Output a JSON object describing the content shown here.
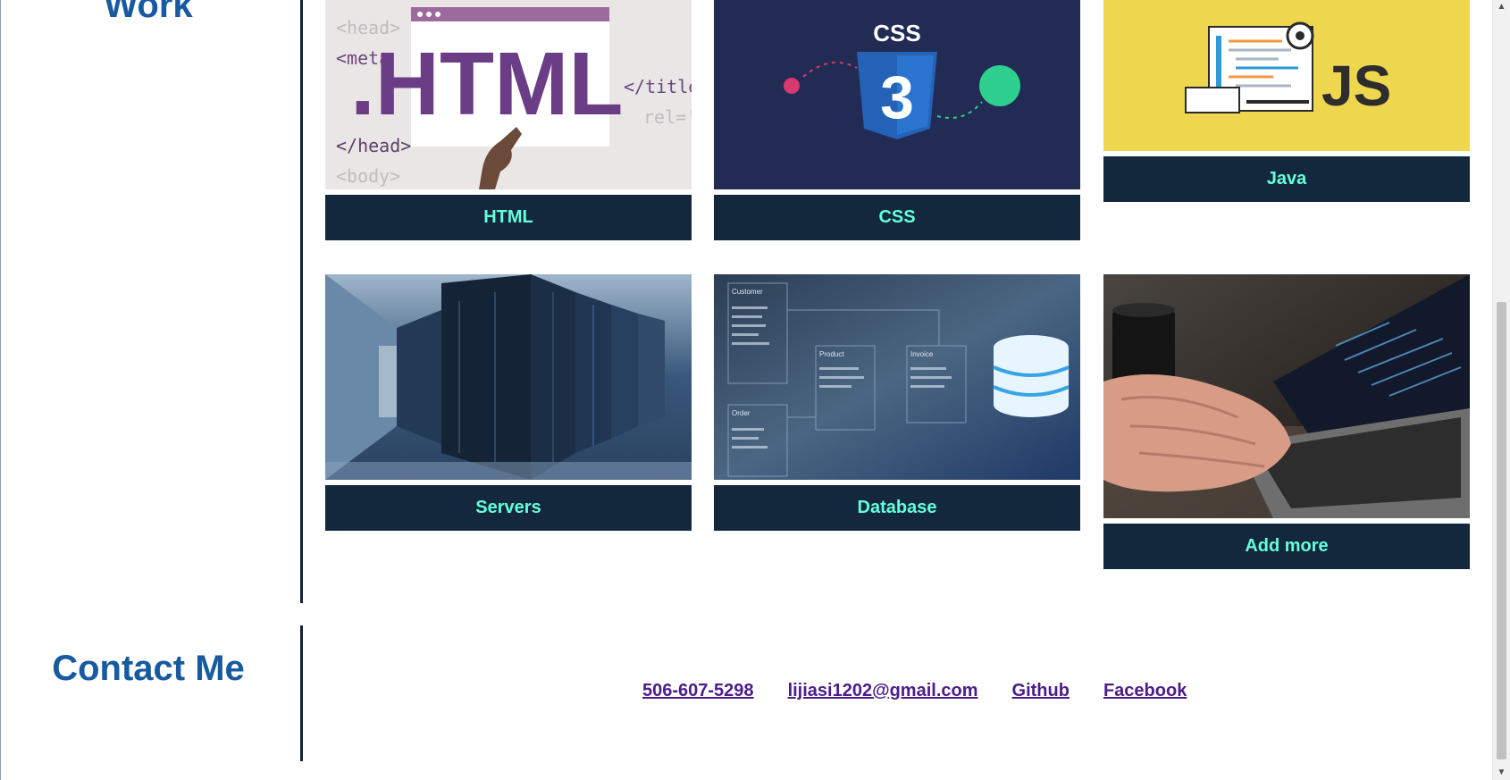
{
  "sections": {
    "work_title": "Work",
    "contact_title": "Contact Me"
  },
  "cards": [
    {
      "id": "html",
      "label": "HTML",
      "image": "html-code-logo-image"
    },
    {
      "id": "css",
      "label": "CSS",
      "image": "css3-shield-logo-image"
    },
    {
      "id": "java",
      "label": "Java",
      "image": "js-laptop-illustration-image"
    },
    {
      "id": "servers",
      "label": "Servers",
      "image": "server-room-photo"
    },
    {
      "id": "database",
      "label": "Database",
      "image": "database-schema-photo"
    },
    {
      "id": "add_more",
      "label": "Add more",
      "image": "laptop-typing-photo"
    }
  ],
  "contact": {
    "phone": "506-607-5298",
    "email": "lijiasi1202@gmail.com",
    "github": "Github",
    "facebook": "Facebook"
  },
  "image_text": {
    "html_big": ".HTML",
    "html_code_1": "<head>",
    "html_code_2": "<meta",
    "html_code_3": "</head>",
    "html_code_4": "<body>",
    "html_code_5": "</title",
    "html_code_6": "rel='",
    "css_badge": "CSS",
    "css_number": "3",
    "js_text": "JS",
    "db_customer": "Customer",
    "db_product": "Product",
    "db_invoice": "Invoice",
    "db_order": "Order"
  },
  "colors": {
    "heading": "#175aa0",
    "label_bg": "#13283d",
    "label_text": "#64ffda",
    "link": "#4b1c8a",
    "divider": "#0f2236"
  }
}
